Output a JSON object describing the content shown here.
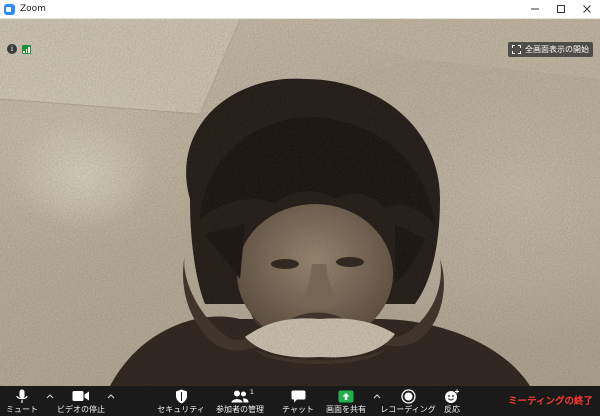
{
  "window": {
    "title": "Zoom"
  },
  "video": {
    "fullscreen_label": "全画面表示の開始",
    "info_icon": "info-icon",
    "signal_icon": "signal-icon"
  },
  "toolbar": {
    "mute_label": "ミュート",
    "video_label": "ビデオの停止",
    "security_label": "セキュリティ",
    "participants_label": "参加者の管理",
    "participants_count": "1",
    "chat_label": "チャット",
    "share_label": "画面を共有",
    "record_label": "レコーディング",
    "reactions_label": "反応",
    "end_label": "ミーティングの終了"
  },
  "colors": {
    "toolbar_bg": "#1a1a1a",
    "share_green": "#22b14c",
    "end_red": "#ff3b30",
    "accent": "#2d8cff"
  }
}
